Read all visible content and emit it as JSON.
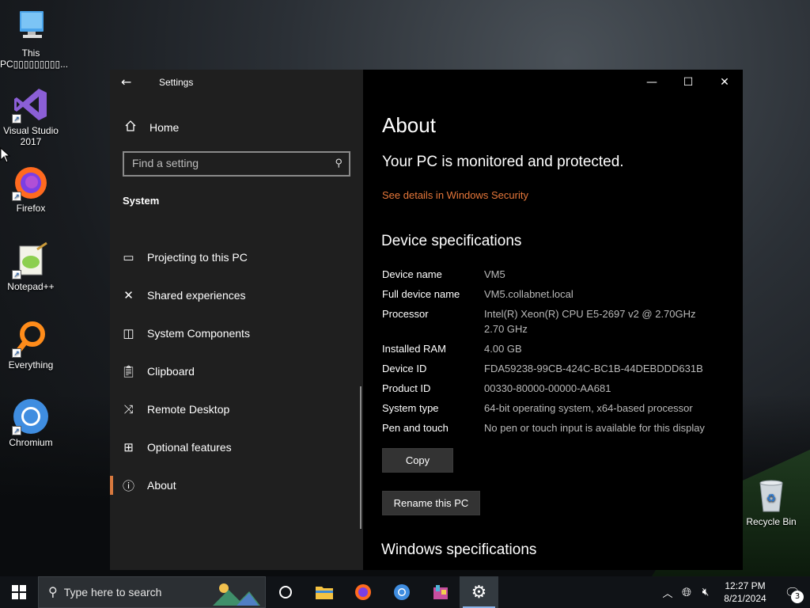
{
  "desktop": {
    "icons": [
      {
        "label_line1": "This",
        "label_line2": "PC▯▯▯▯▯▯▯▯▯...",
        "icon": "computer-icon"
      },
      {
        "label_line1": "Visual Studio",
        "label_line2": "2017",
        "icon": "visual-studio-icon"
      },
      {
        "label_line1": "Firefox",
        "icon": "firefox-icon"
      },
      {
        "label_line1": "Notepad++",
        "icon": "notepadpp-icon"
      },
      {
        "label_line1": "Everything",
        "icon": "everything-icon"
      },
      {
        "label_line1": "Chromium",
        "icon": "chromium-icon"
      },
      {
        "label_line1": "Recycle Bin",
        "icon": "recycle-bin-icon"
      }
    ]
  },
  "settings": {
    "title": "Settings",
    "home_label": "Home",
    "search_placeholder": "Find a setting",
    "section_label": "System",
    "nav_items": [
      {
        "label": "Projecting to this PC",
        "icon": "projector-icon"
      },
      {
        "label": "Shared experiences",
        "icon": "shared-icon"
      },
      {
        "label": "System Components",
        "icon": "components-icon"
      },
      {
        "label": "Clipboard",
        "icon": "clipboard-icon"
      },
      {
        "label": "Remote Desktop",
        "icon": "remote-desktop-icon"
      },
      {
        "label": "Optional features",
        "icon": "optional-features-icon"
      },
      {
        "label": "About",
        "icon": "info-icon",
        "active": true
      }
    ],
    "about": {
      "title": "About",
      "protected_text": "Your PC is monitored and protected.",
      "security_link": "See details in Windows Security",
      "device_specs_heading": "Device specifications",
      "specs": [
        {
          "key": "Device name",
          "value": "VM5"
        },
        {
          "key": "Full device name",
          "value": "VM5.collabnet.local"
        },
        {
          "key": "Processor",
          "value": "Intel(R) Xeon(R) CPU E5-2697 v2 @ 2.70GHz 2.70 GHz"
        },
        {
          "key": "Installed RAM",
          "value": "4.00 GB"
        },
        {
          "key": "Device ID",
          "value": "FDA59238-99CB-424C-BC1B-44DEBDDD631B"
        },
        {
          "key": "Product ID",
          "value": "00330-80000-00000-AA681"
        },
        {
          "key": "System type",
          "value": "64-bit operating system, x64-based processor"
        },
        {
          "key": "Pen and touch",
          "value": "No pen or touch input is available for this display"
        }
      ],
      "copy_label": "Copy",
      "rename_label": "Rename this PC",
      "windows_specs_heading": "Windows specifications"
    }
  },
  "taskbar": {
    "search_placeholder": "Type here to search",
    "time": "12:27 PM",
    "date": "8/21/2024",
    "notification_count": "3",
    "accent": "#8ab4e8"
  },
  "colors": {
    "link": "#e6773a",
    "active_indicator": "#d8793e"
  }
}
